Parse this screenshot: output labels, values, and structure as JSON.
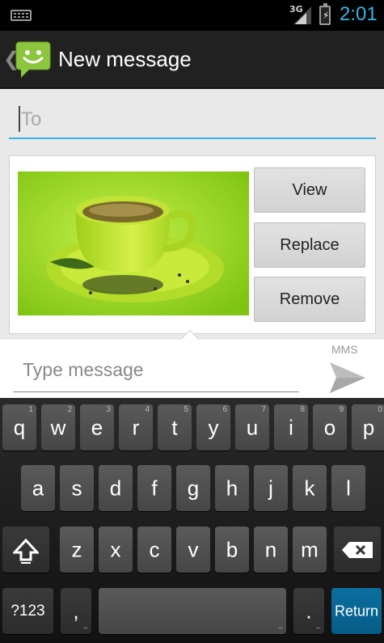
{
  "status_bar": {
    "network": "3G",
    "time": "2:01"
  },
  "action_bar": {
    "title": "New message",
    "icon": "messaging-app-icon"
  },
  "compose": {
    "to_placeholder": "To",
    "attachment_buttons": {
      "view": "View",
      "replace": "Replace",
      "remove": "Remove"
    },
    "message_placeholder": "Type message",
    "mms_label": "MMS",
    "send_icon": "send-icon"
  },
  "keyboard": {
    "row1": [
      {
        "key": "q",
        "hint": "1"
      },
      {
        "key": "w",
        "hint": "2"
      },
      {
        "key": "e",
        "hint": "3"
      },
      {
        "key": "r",
        "hint": "4"
      },
      {
        "key": "t",
        "hint": "5"
      },
      {
        "key": "y",
        "hint": "6"
      },
      {
        "key": "u",
        "hint": "7"
      },
      {
        "key": "i",
        "hint": "8"
      },
      {
        "key": "o",
        "hint": "9"
      },
      {
        "key": "p",
        "hint": "0"
      }
    ],
    "row2": [
      "a",
      "s",
      "d",
      "f",
      "g",
      "h",
      "j",
      "k",
      "l"
    ],
    "row3": [
      "z",
      "x",
      "c",
      "v",
      "b",
      "n",
      "m"
    ],
    "symbols": "?123",
    "comma": ",",
    "period": ".",
    "return": "Return"
  },
  "colors": {
    "accent": "#33b5e5",
    "action_bar": "#212121",
    "return_key": "#0a6fa0"
  }
}
